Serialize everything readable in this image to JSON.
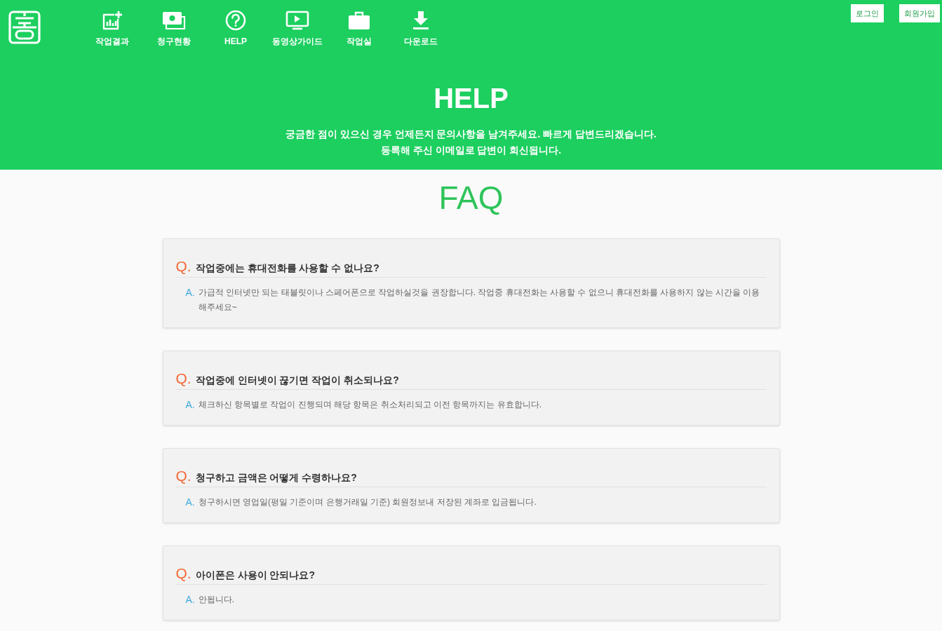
{
  "header": {
    "nav": [
      "작업결과",
      "청구현황",
      "HELP",
      "동영상가이드",
      "작업실",
      "다운로드"
    ],
    "auth_buttons": [
      "로그인",
      "회원가입"
    ]
  },
  "hero": {
    "title": "HELP",
    "lines": [
      "궁금한 점이 있으신 경우 언제든지 문의사항을 남겨주세요. 빠르게 답변드리겠습니다.",
      "등록해 주신 이메일로 답변이 회신됩니다."
    ]
  },
  "faq": {
    "title": "FAQ",
    "items": [
      {
        "q_mark": "Q.",
        "question": "작업중에는 휴대전화를 사용할 수 없나요?",
        "a_mark": "A.",
        "answer": "가급적 인터넷만 되는 태블릿이나 스페어폰으로 작업하실것을 권장합니다. 작업중 휴대전화는 사용할 수 없으니 휴대전화를 사용하지 않는 시간을 이용해주세요~"
      },
      {
        "q_mark": "Q.",
        "question": "작업중에 인터넷이 끊기면 작업이 취소되나요?",
        "a_mark": "A.",
        "answer": "체크하신 항목별로 작업이 진행되며 해당 항목은 취소처리되고 이전 항목까지는 유효합니다."
      },
      {
        "q_mark": "Q.",
        "question": "청구하고 금액은 어떻게 수령하나요?",
        "a_mark": "A.",
        "answer": "청구하시면 영업일(평일 기준이며 은행거래일 기준) 회원정보내 저장된 계좌로 입금됩니다."
      },
      {
        "q_mark": "Q.",
        "question": "아이폰은 사용이 안되나요?",
        "a_mark": "A.",
        "answer": "안됩니다."
      }
    ]
  }
}
